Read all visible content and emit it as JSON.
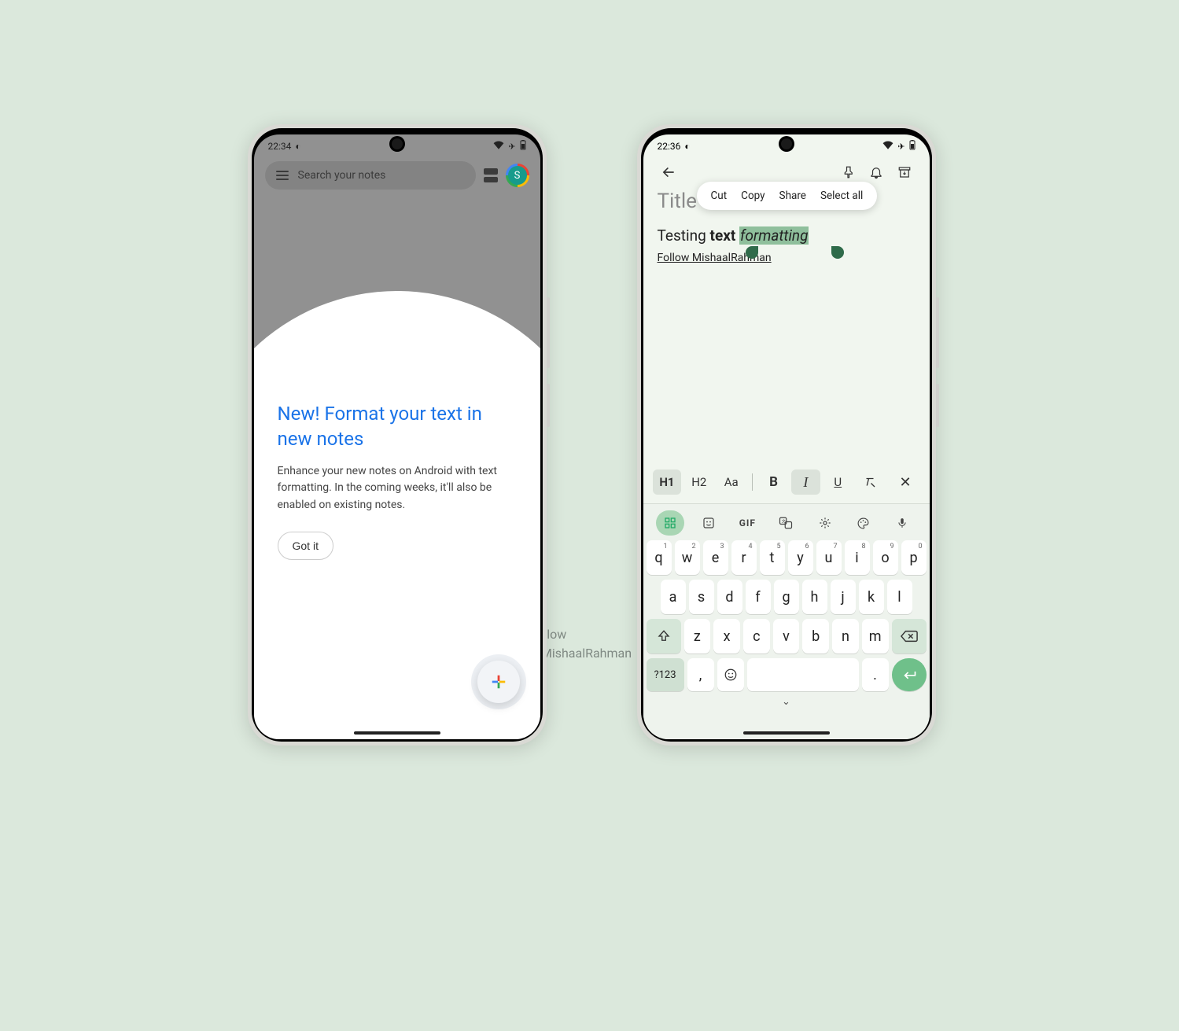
{
  "watermark": {
    "line1": "Follow",
    "line2": "@MishaalRahman"
  },
  "left": {
    "status": {
      "time": "22:34",
      "icons": "◐",
      "wifi": "▾",
      "plane": "✈",
      "batt": "▮"
    },
    "search": {
      "placeholder": "Search your notes",
      "avatar_letter": "S"
    },
    "promo": {
      "heading": "New! Format your text in new notes",
      "body": "Enhance your new notes on Android with text formatting. In the coming weeks, it'll also be enabled on existing notes.",
      "cta": "Got it"
    }
  },
  "right": {
    "status": {
      "time": "22:36",
      "icons": "◐",
      "wifi": "▾",
      "plane": "✈",
      "batt": "▮"
    },
    "title_hint": "Title",
    "context": {
      "cut": "Cut",
      "copy": "Copy",
      "share": "Share",
      "selectall": "Select all"
    },
    "note": {
      "w1": "Testing ",
      "w2": "text ",
      "w3": "formatting",
      "follow": "Follow MishaalRahman"
    },
    "format": {
      "h1": "H1",
      "h2": "H2",
      "aa": "Aa",
      "b": "B",
      "i": "I",
      "u": "U",
      "clear": "✕̶",
      "close": "✕"
    },
    "kb_tools": {
      "grid": "⊞",
      "sticker": "☺",
      "gif": "GIF",
      "translate": "⇄",
      "gear": "⚙",
      "palette": "🎨",
      "mic": "🎤"
    },
    "keys": {
      "row1": [
        "q",
        "w",
        "e",
        "r",
        "t",
        "y",
        "u",
        "i",
        "o",
        "p"
      ],
      "row1sup": [
        "1",
        "2",
        "3",
        "4",
        "5",
        "6",
        "7",
        "8",
        "9",
        "0"
      ],
      "row2": [
        "a",
        "s",
        "d",
        "f",
        "g",
        "h",
        "j",
        "k",
        "l"
      ],
      "row3": [
        "z",
        "x",
        "c",
        "v",
        "b",
        "n",
        "m"
      ],
      "sym": "?123",
      "comma": ",",
      "dot": ".",
      "emoji": "☺",
      "enter": "↵",
      "bksp": "⌫",
      "shift": "⇧",
      "collapse": "⌄"
    }
  }
}
